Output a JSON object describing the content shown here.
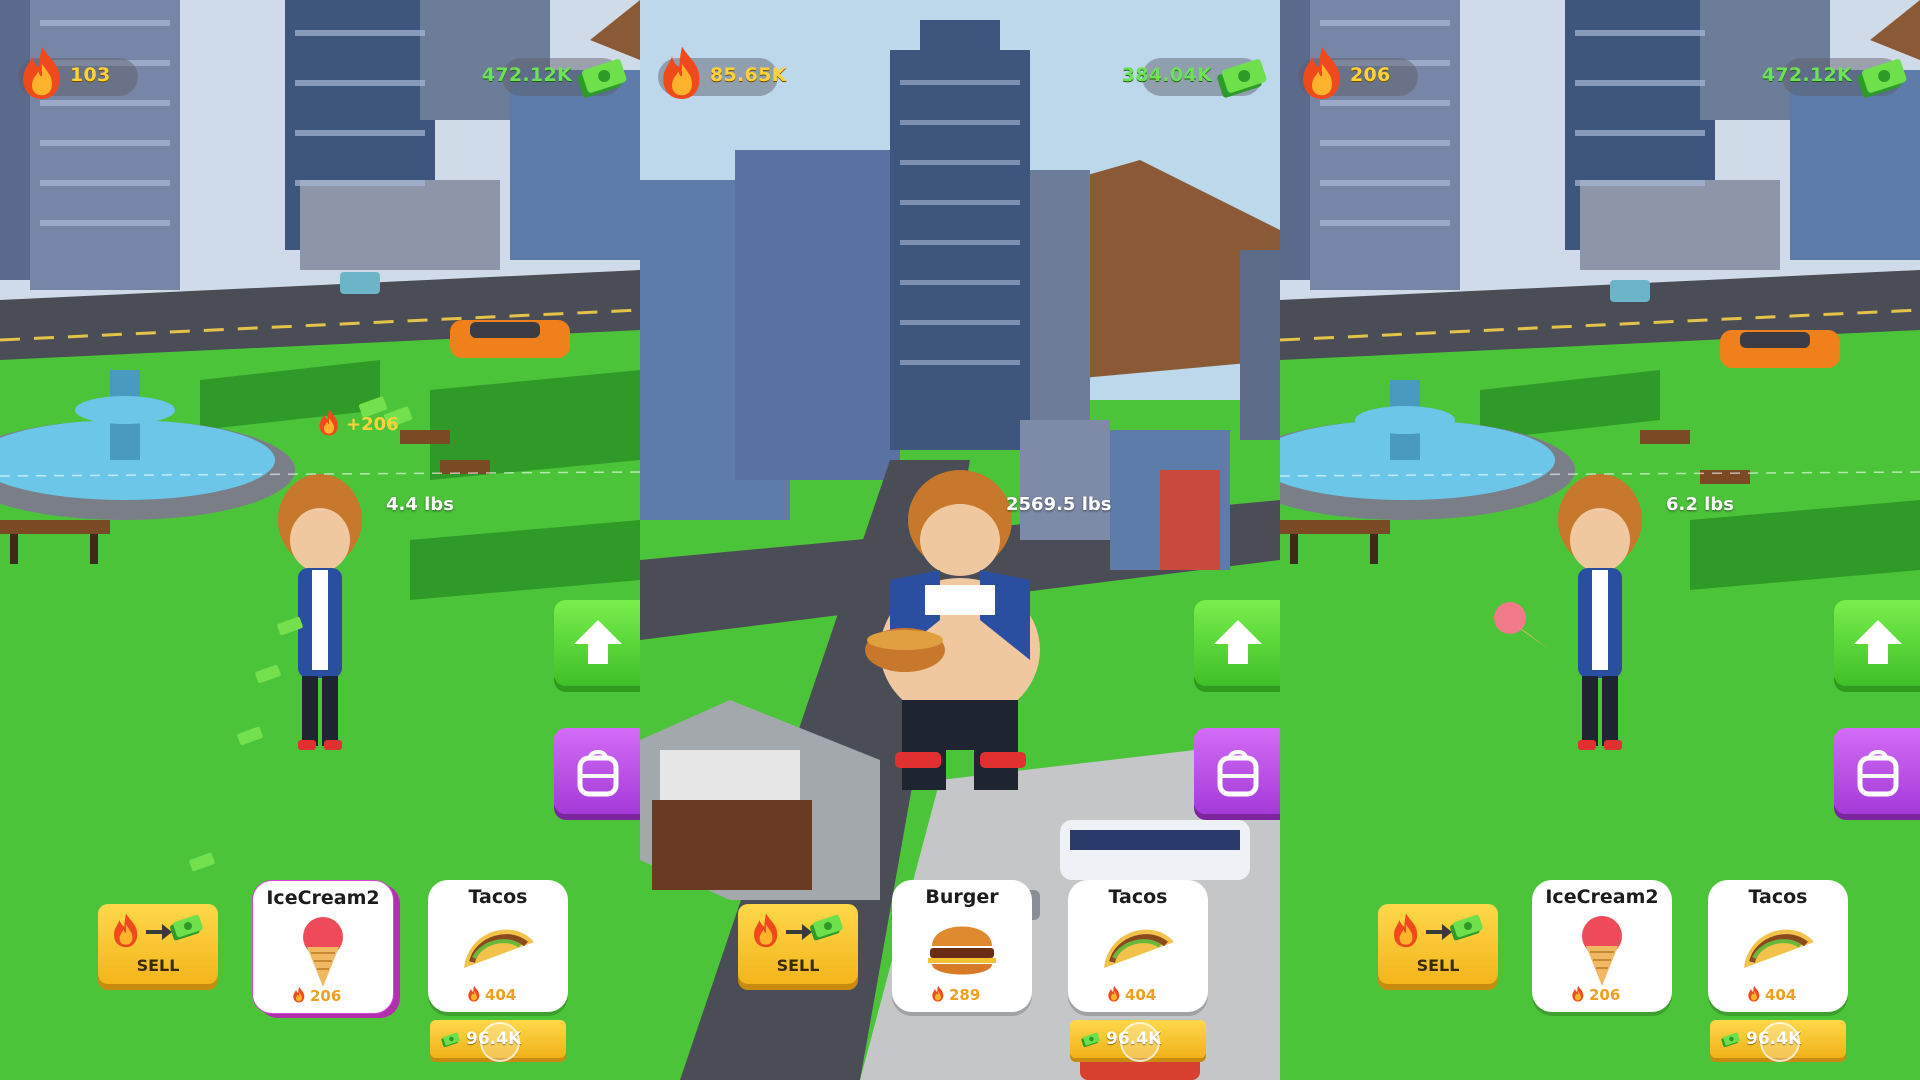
{
  "panels": [
    {
      "hud": {
        "kcal": "103",
        "cash": "472.12K"
      },
      "weight": "4.4 lbs",
      "floating_gain": "+206",
      "sell_label": "SELL",
      "cards": [
        {
          "title": "IceCream2",
          "kcal": "206",
          "icon": "ice-cream-icon",
          "selected": true
        },
        {
          "title": "Tacos",
          "kcal": "404",
          "icon": "taco-icon",
          "price": "96.4K"
        }
      ]
    },
    {
      "hud": {
        "kcal": "85.65K",
        "cash": "384.04K"
      },
      "weight": "2569.5 lbs",
      "sell_label": "SELL",
      "cards": [
        {
          "title": "Burger",
          "kcal": "289",
          "icon": "burger-icon"
        },
        {
          "title": "Tacos",
          "kcal": "404",
          "icon": "taco-icon",
          "price": "96.4K"
        }
      ]
    },
    {
      "hud": {
        "kcal": "206",
        "cash": "472.12K"
      },
      "weight": "6.2 lbs",
      "sell_label": "SELL",
      "cards": [
        {
          "title": "IceCream2",
          "kcal": "206",
          "icon": "ice-cream-icon"
        },
        {
          "title": "Tacos",
          "kcal": "404",
          "icon": "taco-icon",
          "price": "96.4K"
        }
      ]
    }
  ],
  "colors": {
    "grass": "#4cc43a",
    "road": "#4a4d55",
    "sky": "#bcd8ea",
    "kcal": "#ffd23a",
    "cash": "#6fe05a",
    "upgrade_button": "#52d634",
    "backpack_button": "#b84fe6",
    "sell_button": "#f8c52a"
  }
}
